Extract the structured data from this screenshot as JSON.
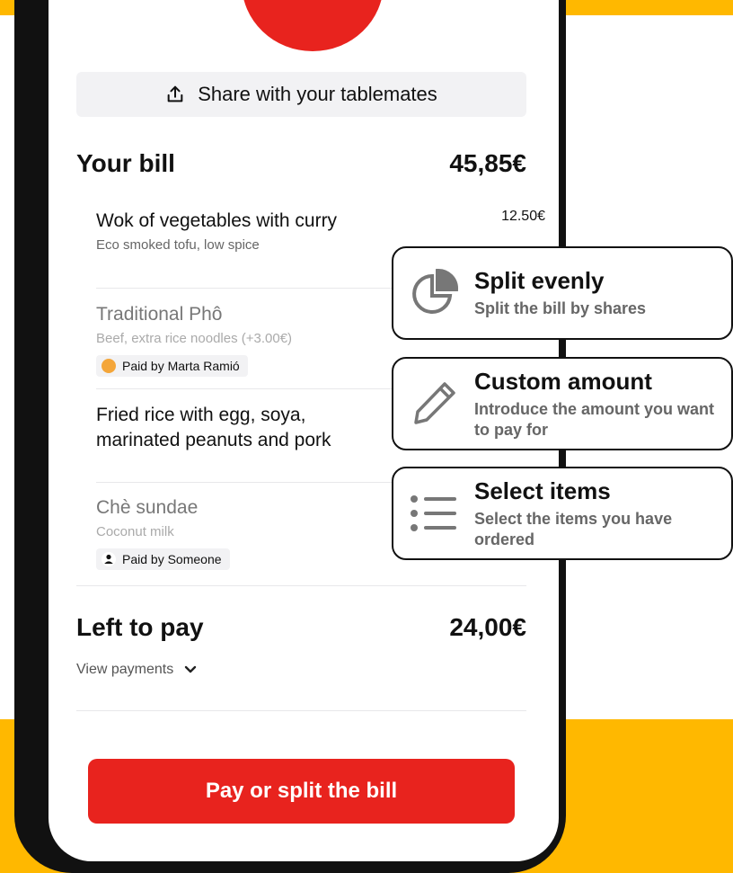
{
  "share": {
    "label": "Share with your tablemates"
  },
  "bill": {
    "title": "Your bill",
    "total": "45,85€"
  },
  "items": [
    {
      "name": "Wok of vegetables with curry",
      "desc": "Eco smoked tofu, low spice",
      "price": "12.50€"
    },
    {
      "name": "Traditional Phô",
      "desc": "Beef, extra rice noodles (+3.00€)",
      "paid_by": "Paid by Marta Ramió"
    },
    {
      "name": "Fried rice with egg, soya, marinated peanuts and pork"
    },
    {
      "name": "Chè sundae",
      "desc": "Coconut milk",
      "paid_by": "Paid by Someone"
    }
  ],
  "left": {
    "title": "Left to pay",
    "amount": "24,00€"
  },
  "view_payments": "View payments",
  "pay_button": "Pay or split the bill",
  "options": [
    {
      "title": "Split evenly",
      "desc": "Split the bill by shares",
      "icon": "pie-chart-icon"
    },
    {
      "title": "Custom amount",
      "desc": "Introduce the amount you want to pay for",
      "icon": "pencil-icon"
    },
    {
      "title": "Select items",
      "desc": "Select the items you have ordered",
      "icon": "list-icon"
    }
  ],
  "colors": {
    "accent_red": "#E8231E",
    "brand_yellow": "#FFB800"
  }
}
